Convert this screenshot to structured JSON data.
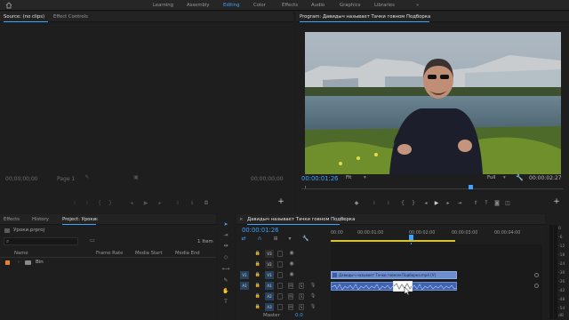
{
  "workspaces": [
    "Learning",
    "Assembly",
    "Editing",
    "Color",
    "Effects",
    "Audio",
    "Graphics",
    "Libraries"
  ],
  "workspace_more": "»",
  "source": {
    "tab": "Source: (no clips)",
    "tab2": "Effect Controls",
    "tc_left": "00;00;00;00",
    "tc_right": "00;00;00;00",
    "page": "Page 1"
  },
  "program": {
    "title": "Program: Давидыч называет Тачки говном Подборка",
    "timecode": "00:00:01:26",
    "fit": "Fit",
    "quality": "Full",
    "duration": "00:00:02:27"
  },
  "project": {
    "tabs": [
      "Effects",
      "History",
      "Project: Уроки"
    ],
    "filename": "Уроки.prproj",
    "item_count": "1 Item",
    "columns": [
      "Name",
      "Frame Rate",
      "Media Start",
      "Media End"
    ],
    "bin_name": "Bin"
  },
  "timeline": {
    "title": "Давидыч называет Тачки говном Подборка",
    "timecode": "00:00:01:26",
    "ruler": [
      "00:00",
      "00:00:01:00",
      "00:00:02:00",
      "00:00:03:00",
      "00:00:04:00"
    ],
    "video_tracks": [
      "V3",
      "V2",
      "V1"
    ],
    "audio_tracks": [
      "A1",
      "A2",
      "A3"
    ],
    "master": "Master",
    "master_val": "0.0",
    "clip_label": "Давидыч называет Тачки говном Подборка.mp4 [V]",
    "toggle_m": "M",
    "toggle_s": "S",
    "target_v": "V1",
    "target_a": "A1"
  },
  "meter": {
    "scale": [
      "0",
      "-6",
      "-12",
      "-18",
      "-24",
      "-30",
      "-36",
      "-42",
      "-48",
      "-54"
    ],
    "unit": "dB"
  },
  "colors": {
    "accent": "#3ea2ff",
    "clip_video": "#6d8fd0",
    "clip_audio": "#3f63b0"
  }
}
